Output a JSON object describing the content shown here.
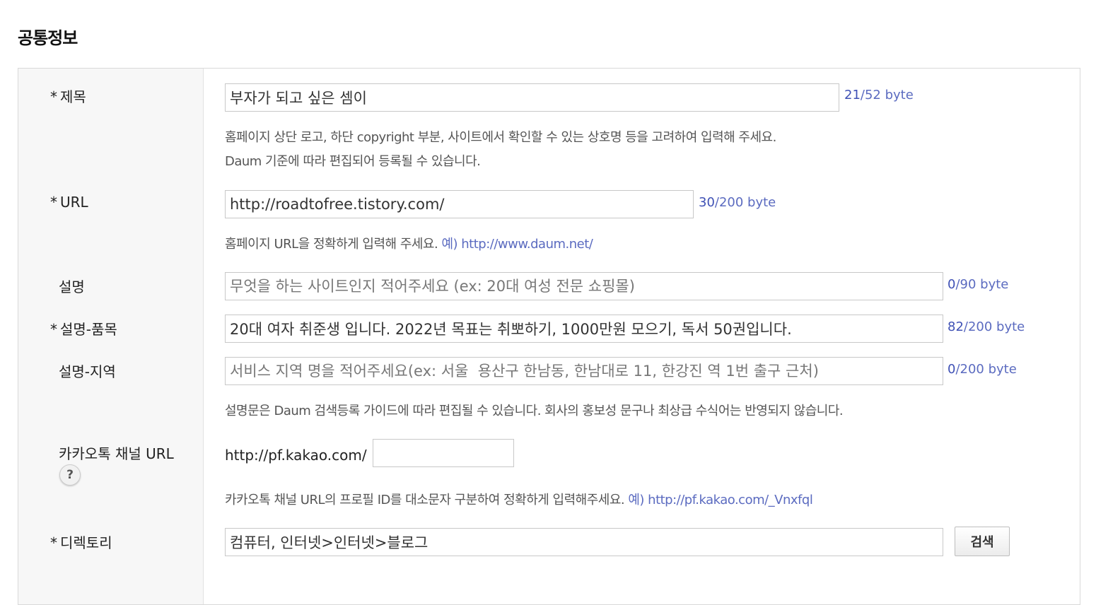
{
  "section_title": "공통정보",
  "required_mark": "*",
  "fields": {
    "title": {
      "label": "제목",
      "value": "부자가 되고 싶은 셈이",
      "byte_count": "21",
      "byte_limit": "/52 byte",
      "help_line1": "홈페이지 상단 로고, 하단 copyright 부분, 사이트에서 확인할 수 있는 상호명 등을 고려하여 입력해 주세요.",
      "help_line2": "Daum 기준에 따라 편집되어 등록될 수 있습니다."
    },
    "url": {
      "label": "URL",
      "value": "http://roadtofree.tistory.com/",
      "byte_count": "30",
      "byte_limit": "/200 byte",
      "help": "홈페이지 URL을 정확하게 입력해 주세요.",
      "example": "예) http://www.daum.net/"
    },
    "description": {
      "label": "설명",
      "placeholder": "무엇을 하는 사이트인지 적어주세요 (ex: 20대 여성 전문 쇼핑몰)",
      "byte_count": "0",
      "byte_limit": "/90 byte"
    },
    "description_item": {
      "label": "설명-품목",
      "value": "20대 여자 취준생 입니다. 2022년 목표는 취뽀하기, 1000만원 모으기, 독서 50권입니다.",
      "byte_count": "82",
      "byte_limit": "/200 byte"
    },
    "description_region": {
      "label": "설명-지역",
      "placeholder": "서비스 지역 명을 적어주세요(ex: 서울  용산구 한남동, 한남대로 11, 한강진 역 1번 출구 근처)",
      "byte_count": "0",
      "byte_limit": "/200 byte",
      "help": "설명문은 Daum 검색등록 가이드에 따라 편집될 수 있습니다. 회사의 홍보성 문구나 최상급 수식어는 반영되지 않습니다."
    },
    "kakao": {
      "label": "카카오톡 채널 URL",
      "help_icon": "?",
      "prefix": "http://pf.kakao.com/",
      "value": "",
      "help": "카카오톡 채널 URL의 프로필 ID를 대소문자 구분하여 정확하게 입력해주세요.",
      "example": "예) http://pf.kakao.com/_Vnxfql"
    },
    "directory": {
      "label": "디렉토리",
      "value": "컴퓨터, 인터넷>인터넷>블로그",
      "search_button": "검색"
    }
  },
  "colors": {
    "accent_link": "#5b6bc0",
    "label_bg": "#f7f7f7",
    "border": "#c8c8c8"
  }
}
